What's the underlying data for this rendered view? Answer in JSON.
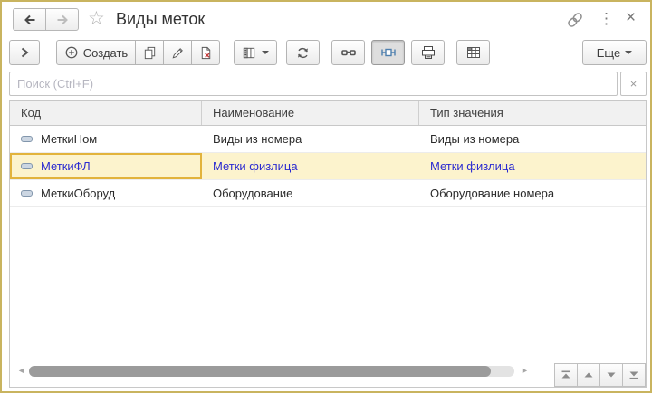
{
  "window": {
    "title": "Виды меток"
  },
  "icons": {
    "star": "☆",
    "kebab": "⋮",
    "close": "×",
    "clear": "×",
    "scroll_left": "◄",
    "scroll_right": "►"
  },
  "toolbar": {
    "create_label": "Создать",
    "more_label": "Еще"
  },
  "search": {
    "placeholder": "Поиск (Ctrl+F)"
  },
  "table": {
    "columns": [
      "Код",
      "Наименование",
      "Тип значения"
    ],
    "rows": [
      {
        "code": "МеткиНом",
        "name": "Виды из номера",
        "type": "Виды из номера",
        "selected": false
      },
      {
        "code": "МеткиФЛ",
        "name": "Метки физлица",
        "type": "Метки физлица",
        "selected": true
      },
      {
        "code": "МеткиОборуд",
        "name": "Оборудование",
        "type": "Оборудование номера",
        "selected": false
      }
    ]
  },
  "colors": {
    "window_border": "#c9b45f",
    "header_bg": "#f1f1f1",
    "selected_row_bg": "#fcf3cd",
    "selected_text": "#2b2bd0",
    "active_cell_border": "#e2b33c",
    "toolbar_icon": "#565656",
    "accent_blue": "#4e7fae",
    "delete_x": "#c43b3b"
  }
}
